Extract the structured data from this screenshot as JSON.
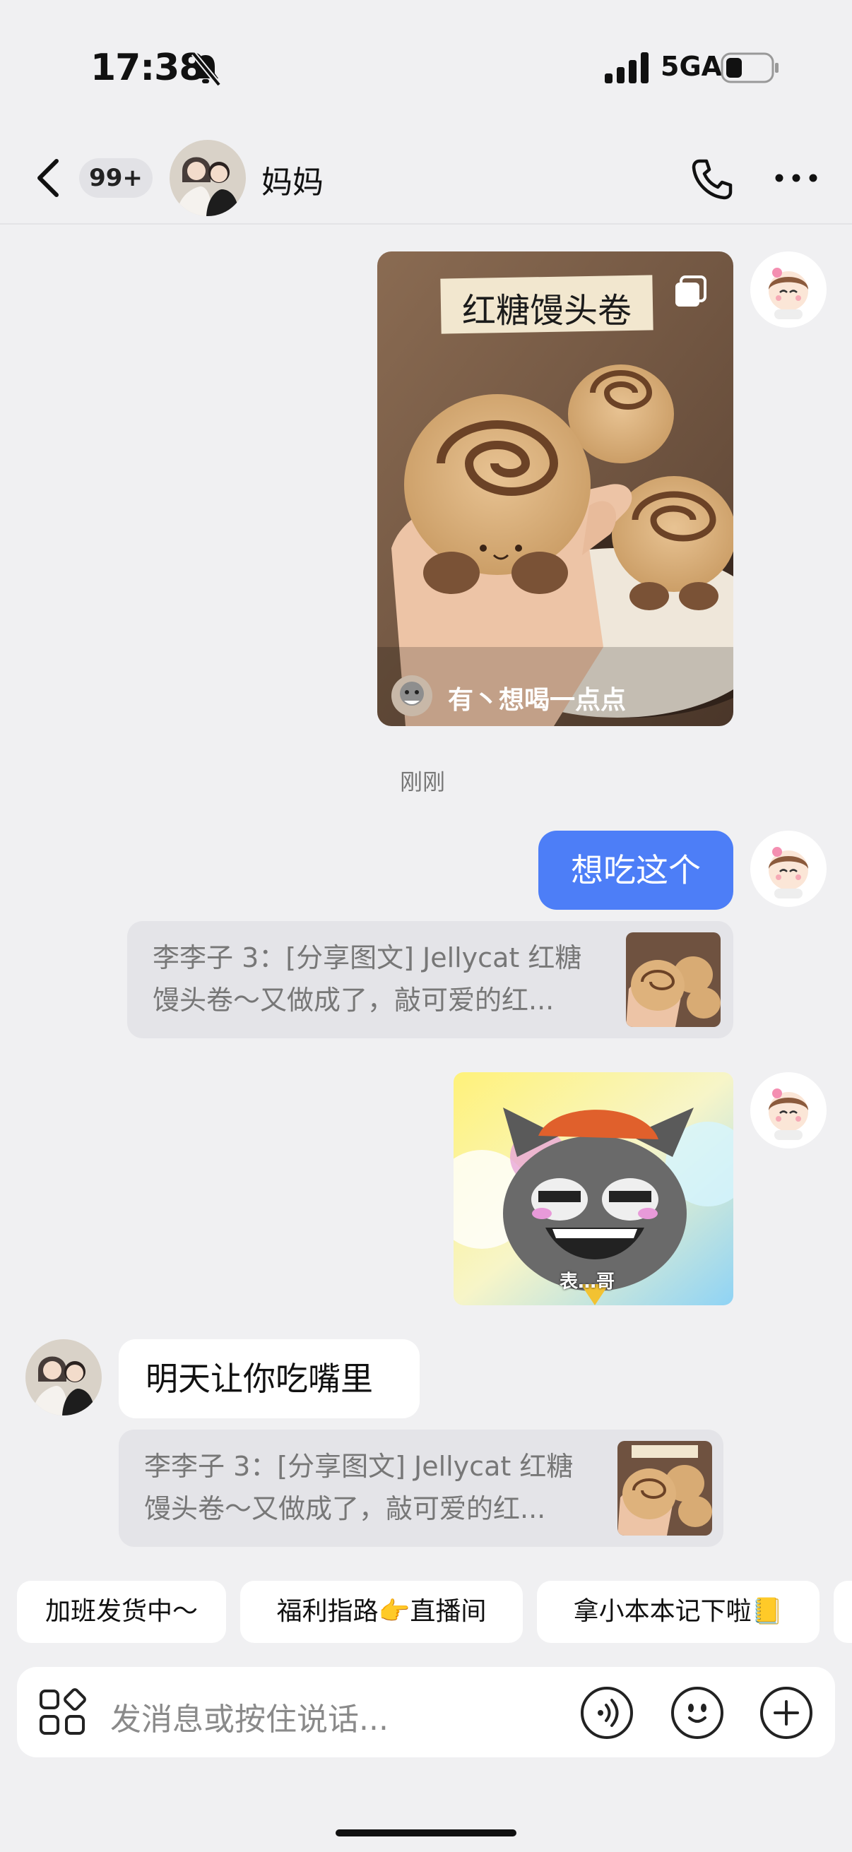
{
  "status_bar": {
    "time": "17:38",
    "network": "5GA",
    "icons": [
      "bell-mute-icon",
      "signal-icon",
      "battery-icon"
    ]
  },
  "nav": {
    "unread_badge": "99+",
    "title": "妈妈",
    "icons": [
      "back-chevron-icon",
      "phone-icon",
      "more-icon"
    ]
  },
  "messages": {
    "card": {
      "title": "红糖馒头卷",
      "author": "有丶想喝一点点"
    },
    "timestamp": "刚刚",
    "text_1": "想吃这个",
    "quote_1": {
      "line1": "李李子 3：[分享图文] Jellycat 红糖",
      "line2": "馒头卷～又做成了，敲可爱的红..."
    },
    "sticker_caption": "表…哥",
    "reply_text": "明天让你吃嘴里",
    "quote_2": {
      "line1": "李李子 3：[分享图文] Jellycat 红糖",
      "line2": "馒头卷～又做成了，敲可爱的红..."
    }
  },
  "quick_replies": [
    {
      "label": "加班发货中～"
    },
    {
      "label": "福利指路👉直播间"
    },
    {
      "label": "拿小本本记下啦📒"
    }
  ],
  "input": {
    "placeholder": "发消息或按住说话..."
  },
  "colors": {
    "accent_blue": "#4d7ef7",
    "background": "#f0f0f2"
  }
}
